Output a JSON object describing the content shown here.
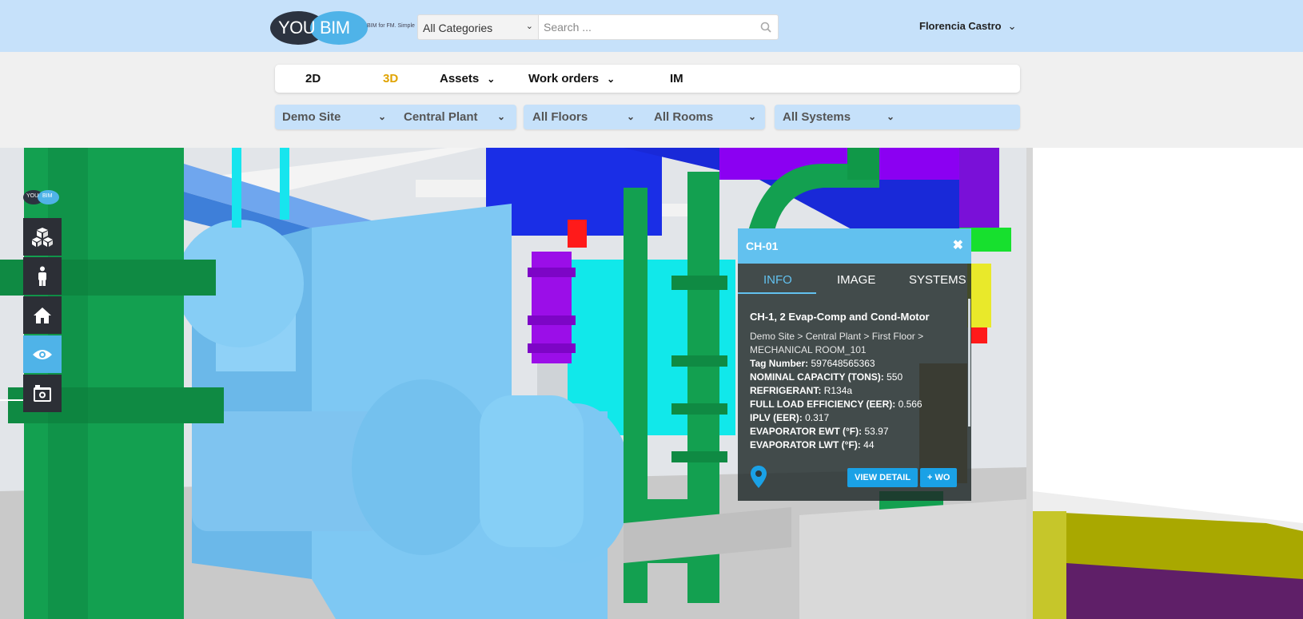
{
  "logo": {
    "part1": "YOU",
    "part2": "BIM",
    "tagline": "BIM for FM. Simple"
  },
  "header": {
    "category": "All Categories",
    "search_placeholder": "Search ...",
    "user_name": "Florencia Castro"
  },
  "nav": {
    "tabs": [
      {
        "label": "2D"
      },
      {
        "label": "3D"
      },
      {
        "label": "Assets"
      },
      {
        "label": "Work orders"
      },
      {
        "label": "IM"
      }
    ]
  },
  "filters": {
    "site": "Demo Site",
    "building": "Central Plant",
    "floor": "All Floors",
    "room": "All Rooms",
    "system": "All Systems"
  },
  "mini_logo": {
    "part1": "YOU",
    "part2": "BIM"
  },
  "tools": [
    "cubes-icon",
    "person-icon",
    "home-icon",
    "eye-icon",
    "camera-icon"
  ],
  "popup": {
    "title": "CH-01",
    "tabs": [
      "INFO",
      "IMAGE",
      "SYSTEMS"
    ],
    "name": "CH-1, 2 Evap-Comp and Cond-Motor",
    "path": "Demo Site > Central Plant > First Floor > MECHANICAL ROOM_101",
    "fields": [
      {
        "label": "Tag Number:",
        "value": "597648565363"
      },
      {
        "label": "NOMINAL CAPACITY (TONS):",
        "value": "550"
      },
      {
        "label": "REFRIGERANT:",
        "value": "R134a"
      },
      {
        "label": "FULL LOAD EFFICIENCY (EER):",
        "value": "0.566"
      },
      {
        "label": "IPLV (EER):",
        "value": "0.317"
      },
      {
        "label": "EVAPORATOR EWT (°F):",
        "value": "53.97"
      },
      {
        "label": "EVAPORATOR LWT (°F):",
        "value": "44"
      }
    ],
    "view_detail": "VIEW DETAIL",
    "add_wo": "+ WO"
  },
  "colors": {
    "header_bg": "#c6e1fa",
    "accent_blue": "#62c1ef",
    "active_tab": "#e0a300",
    "button": "#1aa1e6"
  }
}
